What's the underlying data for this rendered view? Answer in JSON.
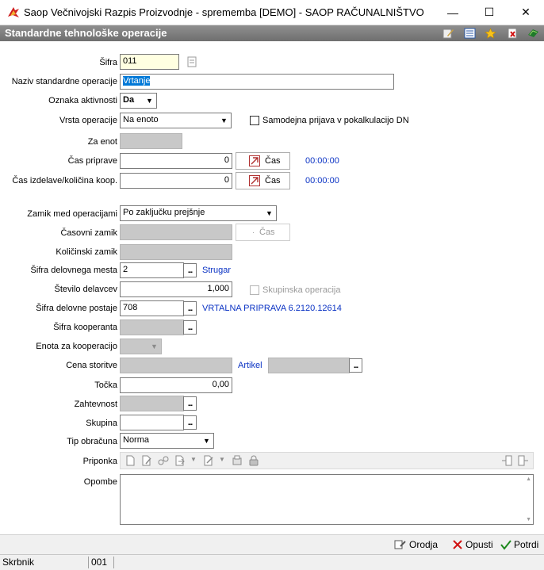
{
  "window": {
    "title": "Saop   Večnivojski Razpis Proizvodnje - sprememba [DEMO] - SAOP RAČUNALNIŠTVO",
    "minimize": "—",
    "maximize": "☐",
    "close": "✕"
  },
  "header": {
    "title": "Standardne tehnološke operacije"
  },
  "form": {
    "sifra": {
      "label": "Šifra",
      "value": "011"
    },
    "naziv": {
      "label": "Naziv standardne operacije",
      "value": "Vrtanje"
    },
    "oznaka": {
      "label": "Oznaka aktivnosti",
      "value": "Da"
    },
    "vrsta": {
      "label": "Vrsta operacije",
      "value": "Na enoto",
      "checkbox_label": "Samodejna prijava v pokalkulacijo DN"
    },
    "za_enot": {
      "label": "Za enot"
    },
    "cas_priprave": {
      "label": "Čas priprave",
      "value": "0",
      "button": "Čas",
      "time": "00:00:00"
    },
    "cas_izdelave": {
      "label": "Čas izdelave/količina koop.",
      "value": "0",
      "button": "Čas",
      "time": "00:00:00"
    },
    "zamik": {
      "label": "Zamik med operacijami",
      "value": "Po zaključku prejšnje"
    },
    "casovni_zamik": {
      "label": "Časovni zamik",
      "button": "Čas"
    },
    "kolicinski_zamik": {
      "label": "Količinski zamik"
    },
    "delovno_mesto": {
      "label": "Šifra delovnega mesta",
      "value": "2",
      "desc": "Strugar"
    },
    "stevilo_delavcev": {
      "label": "Število delavcev",
      "value": "1,000",
      "checkbox_label": "Skupinska operacija"
    },
    "delovna_postaja": {
      "label": "Šifra delovne postaje",
      "value": "708",
      "desc": "VRTALNA PRIPRAVA 6.2120.12614"
    },
    "kooperant": {
      "label": "Šifra kooperanta"
    },
    "enota_koop": {
      "label": "Enota za kooperacijo"
    },
    "cena": {
      "label": "Cena storitve",
      "artikel_label": "Artikel"
    },
    "tocka": {
      "label": "Točka",
      "value": "0,00"
    },
    "zahtevnost": {
      "label": "Zahtevnost"
    },
    "skupina": {
      "label": "Skupina"
    },
    "tip_obracuna": {
      "label": "Tip obračuna",
      "value": "Norma"
    },
    "priponka": {
      "label": "Priponka"
    },
    "opombe": {
      "label": "Opombe"
    },
    "dots": "..."
  },
  "footer": {
    "orodja": "Orodja",
    "opusti": "Opusti",
    "potrdi": "Potrdi"
  },
  "status": {
    "user": "Skrbnik",
    "code": "001"
  }
}
